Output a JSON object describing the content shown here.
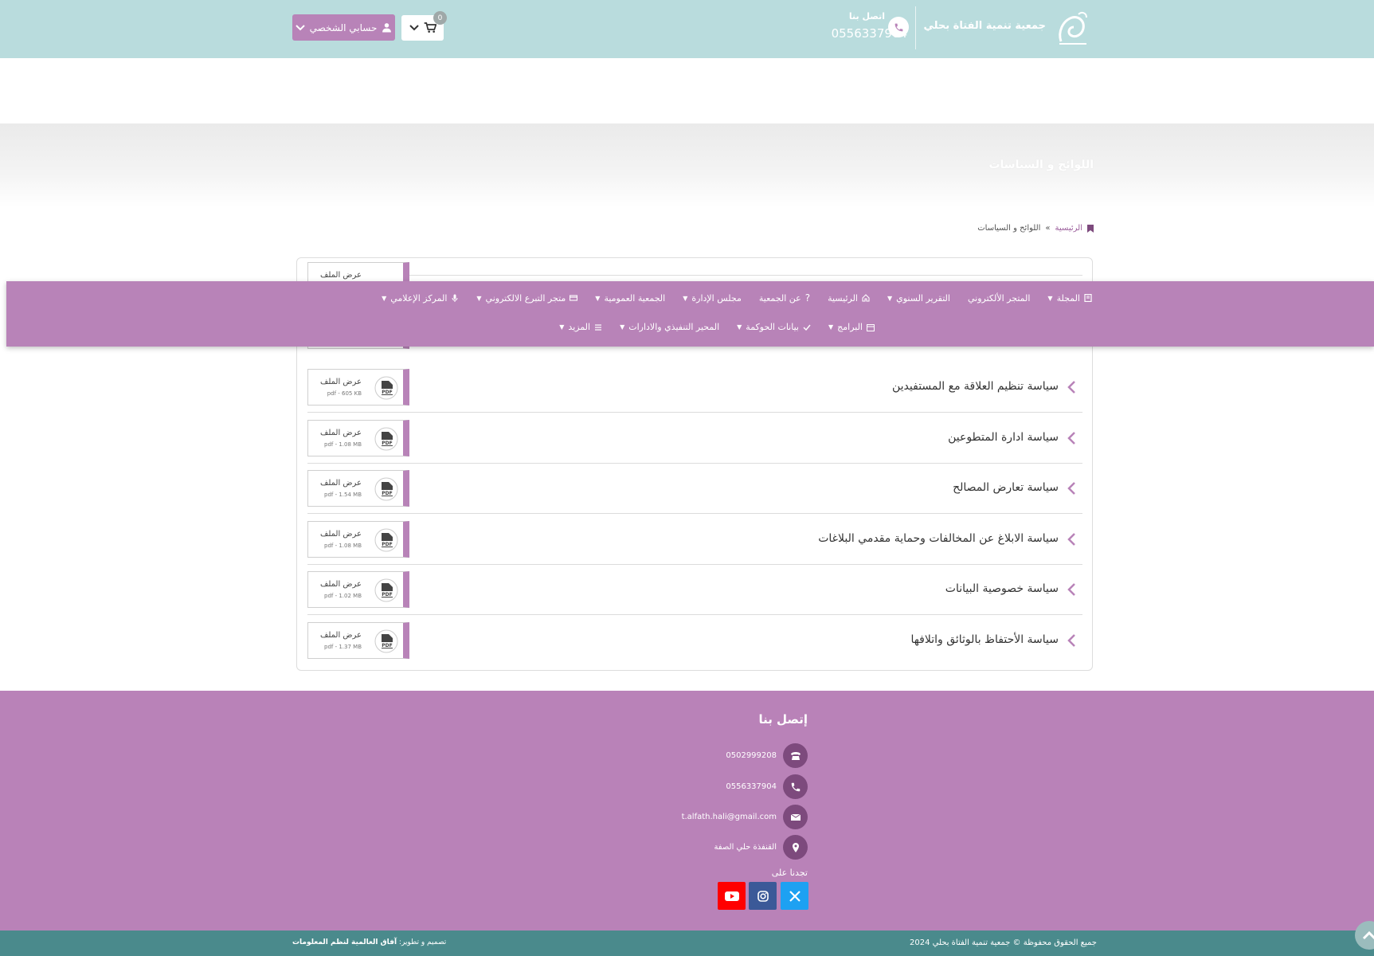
{
  "header": {
    "org_name": "جمعية تنمية الفتاة بحلي",
    "contact_title": "اتصل بنا",
    "contact_phone": "0556337904",
    "cart_count": "0",
    "account_label": "حسابي الشخصي"
  },
  "hero": {
    "title": "اللوائح و السياسات"
  },
  "breadcrumb": {
    "home": "الرئيسية",
    "separator": "»",
    "current": "اللوائح و السياسات"
  },
  "nav": {
    "row1": [
      {
        "label": "المجلة",
        "icon": "book-icon",
        "caret": true
      },
      {
        "label": "المتجر الألكتروني",
        "icon": "",
        "caret": false
      },
      {
        "label": "التقرير السنوي",
        "icon": "",
        "caret": true
      },
      {
        "label": "الرئيسية",
        "icon": "home-icon",
        "caret": false
      },
      {
        "label": "عن الجمعية",
        "icon": "question-icon",
        "caret": false
      },
      {
        "label": "مجلس الإدارة",
        "icon": "",
        "caret": true
      },
      {
        "label": "الجمعية العمومية",
        "icon": "",
        "caret": true
      },
      {
        "label": "متجر التبرع الالكتروني",
        "icon": "card-icon",
        "caret": true
      },
      {
        "label": "المركز الإعلامي",
        "icon": "mic-icon",
        "caret": true
      }
    ],
    "row2": [
      {
        "label": "البرامج",
        "icon": "calendar-icon",
        "caret": true
      },
      {
        "label": "بيانات الحوكمة",
        "icon": "check-icon",
        "caret": true
      },
      {
        "label": "المحير التنفيذي والادارات",
        "icon": "",
        "caret": true
      },
      {
        "label": "المزيد",
        "icon": "list-icon",
        "caret": true
      }
    ]
  },
  "documents": [
    {
      "title": "",
      "file_label": "عرض الملف",
      "file_size": ""
    },
    {
      "title": "",
      "file_label": "",
      "file_size": ""
    },
    {
      "title": "سياسة تنظيم العلاقة مع المستفيدين",
      "file_label": "عرض الملف",
      "file_size": "pdf - 605 KB"
    },
    {
      "title": "سياسة ادارة المتطوعين",
      "file_label": "عرض الملف",
      "file_size": "pdf - 1.08 MB"
    },
    {
      "title": "سياسة تعارض المصالح",
      "file_label": "عرض الملف",
      "file_size": "pdf - 1.54 MB"
    },
    {
      "title": "سياسة الابلاغ عن المخالفات وحماية مقدمي البلاغات",
      "file_label": "عرض الملف",
      "file_size": "pdf - 1.08 MB"
    },
    {
      "title": "سياسة خصوصية البيانات",
      "file_label": "عرض الملف",
      "file_size": "pdf - 1.02 MB"
    },
    {
      "title": "سياسة الأحتفاظ بالوثائق واتلافها",
      "file_label": "عرض الملف",
      "file_size": "pdf - 1.37 MB"
    }
  ],
  "footer": {
    "title": "إتصل بنا",
    "phone_landline": "0502999208",
    "phone_mobile": "0556337904",
    "email": "t.alfath.hali@gmail.com",
    "address": "القنفذة حلي الصفة",
    "find_us": "تجدنا على"
  },
  "bottom": {
    "copyright": "جميع الحقوق محفوظة © جمعية تنمية الفتاة بحلي 2024",
    "credits_prefix": "تصميم و تطوير:",
    "credits_company": "آفاق العالمية لنظم المعلومات"
  },
  "colors": {
    "topbar": "#b9dcdd",
    "accent_purple": "#b883b8",
    "footer_purple": "#b982b8",
    "bottombar": "#4a8a8c"
  }
}
